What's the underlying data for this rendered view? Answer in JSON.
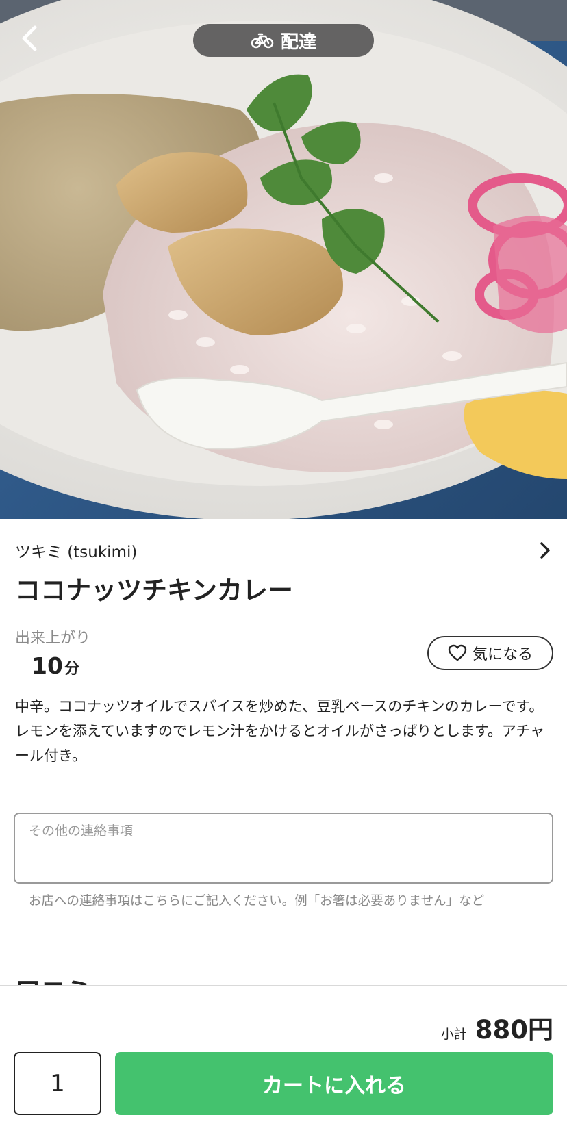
{
  "header": {
    "mode_label": "配達",
    "back_icon": "chevron-left-icon",
    "mode_icon": "bicycle-icon"
  },
  "item": {
    "shop_name": "ツキミ (tsukimi)",
    "title": "ココナッツチキンカレー",
    "ready_label": "出来上がり",
    "ready_time": "10",
    "ready_unit": "分",
    "favorite_label": "気になる",
    "description": "中辛。ココナッツオイルでスパイスを炒めた、豆乳ベースのチキンのカレーです。レモンを添えていますのでレモン汁をかけるとオイルがさっぱりとします。アチャール付き。"
  },
  "note": {
    "placeholder": "その他の連絡事項",
    "value": "",
    "help": "お店への連絡事項はこちらにご記入ください。例「お箸は必要ありません」など"
  },
  "reviews": {
    "heading": "口コミ"
  },
  "footer": {
    "subtotal_label": "小計",
    "subtotal_amount": "880円",
    "quantity": "1",
    "add_to_cart_label": "カートに入れる"
  },
  "colors": {
    "accent_green": "#44c26e",
    "text": "#222222",
    "muted": "#8a8a8a"
  }
}
